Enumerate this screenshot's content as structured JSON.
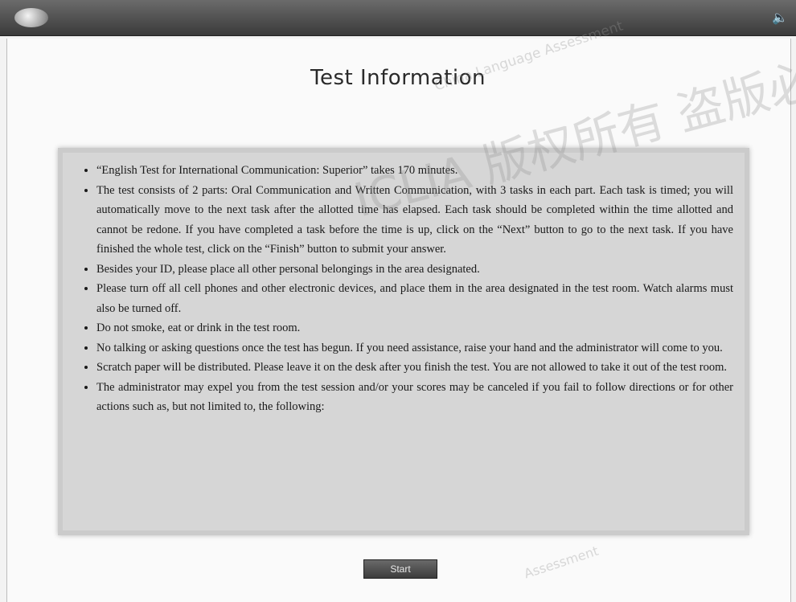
{
  "header": {
    "app_title": "",
    "sound_icon": "speaker-icon"
  },
  "main": {
    "title": "Test Information",
    "bullets": [
      "“English Test for International Communication: Superior” takes 170 minutes.",
      "The test consists of 2 parts: Oral Communication and Written Communication, with 3 tasks in each part. Each task is timed; you will automatically move to the next task after the allotted time has elapsed. Each task should be completed within the time allotted and cannot be redone. If you have completed a task before the time is up, click on the “Next” button to go to the next task. If you have finished the whole test, click on the “Finish” button to submit your answer.",
      "Besides your ID, please place all other personal belongings in the area designated.",
      "Please turn off all cell phones and other electronic devices, and place them in the area designated in the test room. Watch alarms must also be turned off.",
      "Do not smoke, eat or drink in the test room.",
      "No talking or asking questions once the test has begun. If you need assistance, raise your hand and the administrator will come to you.",
      "Scratch paper will be distributed. Please leave it on the desk after you finish the test. You are not allowed to take it out of the test room.",
      "The administrator may expel you from the test session and/or your scores may be canceled if you fail to follow directions or for other actions such as, but not limited to, the following:"
    ],
    "start_button": "Start"
  },
  "watermarks": {
    "top": "China Language Assessment",
    "middle": "ICLIA 版权所有 盗版必究",
    "bottom": "Assessment"
  }
}
